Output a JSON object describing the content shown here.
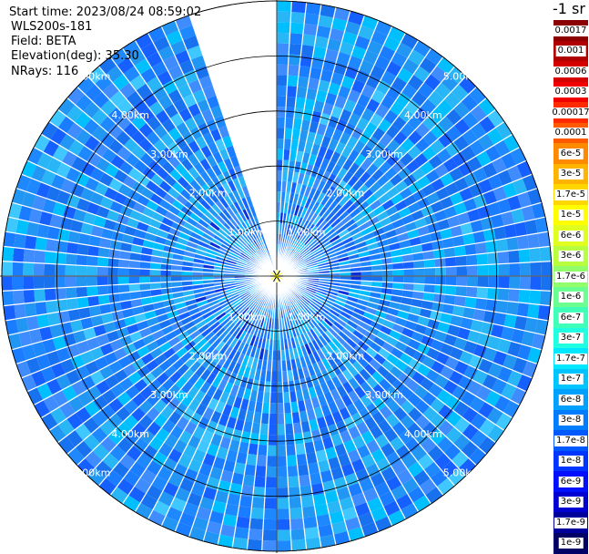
{
  "header": {
    "start_time": "Start time: 2023/08/24 08:59:02",
    "device": "WLS200s-181",
    "field": "Field: BETA",
    "elevation": "Elevation(deg): 35.30",
    "nrays": "NRays: 116"
  },
  "units_label": "-1 sr",
  "chart_data": {
    "type": "heatmap",
    "projection": "polar",
    "nrays": 116,
    "range_rings_km": [
      1.0,
      2.0,
      3.0,
      4.0,
      5.0
    ],
    "ring_labels": [
      "1.00km",
      "2.00km",
      "3.00km",
      "4.00km",
      "5.00km"
    ],
    "max_range_km": 5.0,
    "missing_sector_deg": [
      -20,
      0
    ],
    "dominant_value_range": [
      "1e-9",
      "1e-8"
    ],
    "colorbar": {
      "labels": [
        "0.0017",
        "0.001",
        "0.0006",
        "0.0003",
        "0.00017",
        "0.0001",
        "6e-5",
        "3e-5",
        "1.7e-5",
        "1e-5",
        "6e-6",
        "3e-6",
        "1.7e-6",
        "1e-6",
        "6e-7",
        "3e-7",
        "1.7e-7",
        "1e-7",
        "6e-8",
        "3e-8",
        "1.7e-8",
        "1e-8",
        "6e-9",
        "3e-9",
        "1.7e-9",
        "1e-9"
      ],
      "colors": [
        "#8b0000",
        "#b00000",
        "#d40000",
        "#f00000",
        "#ff2a00",
        "#ff5a00",
        "#ff8a00",
        "#ffb400",
        "#ffd700",
        "#ffff00",
        "#e0ff20",
        "#b8ff40",
        "#90ff6a",
        "#6aff90",
        "#40ffb8",
        "#20ffe0",
        "#00e8ff",
        "#00c4ff",
        "#00a0ff",
        "#007cff",
        "#0058ff",
        "#0034ff",
        "#0010ff",
        "#0000d0",
        "#00009a",
        "#000066"
      ]
    }
  }
}
